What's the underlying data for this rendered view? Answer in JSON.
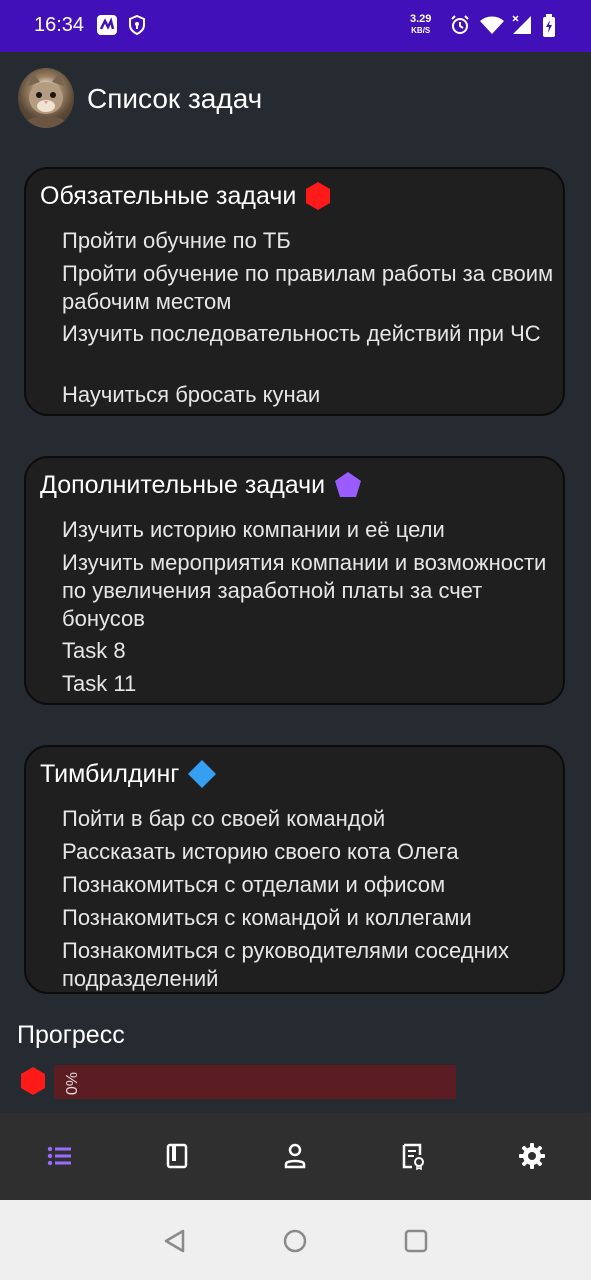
{
  "status_bar": {
    "time": "16:34",
    "net_speed_value": "3.29",
    "net_speed_unit": "KB/S"
  },
  "header": {
    "title": "Список задач",
    "avatar_icon": "cat-avatar"
  },
  "cards": [
    {
      "title": "Обязательные задачи",
      "badge": "red-hexagon-icon",
      "badge_color": "#ff1a1a",
      "tasks": [
        "Пройти обучние по ТБ",
        "Пройти обучение по правилам работы за своим рабочим местом",
        "Изучить последовательность действий при ЧС",
        "Научиться бросать кунаи"
      ]
    },
    {
      "title": "Дополнительные задачи",
      "badge": "purple-pentagon-icon",
      "badge_color": "#9b5cff",
      "tasks": [
        "Изучить историю компании и её цели",
        "Изучить мероприятия компании и возможности по увеличения заработной платы за счет бонусов",
        "Task 8",
        "Task 11"
      ]
    },
    {
      "title": "Тимбилдинг",
      "badge": "blue-diamond-icon",
      "badge_color": "#35a0f2",
      "tasks": [
        "Пойти в бар со своей командой",
        "Рассказать историю своего кота Олега",
        "Познакомиться с отделами и офисом",
        "Познакомиться с командой и коллегами",
        "Познакомиться с руководителями соседних подразделений"
      ]
    }
  ],
  "progress": {
    "label": "Прогресс",
    "icon": "red-hexagon-icon",
    "percent_text": "%0",
    "value_percent": 0
  },
  "bottom_nav": {
    "items": [
      "list-icon",
      "book-icon",
      "person-icon",
      "document-icon",
      "gear-icon"
    ],
    "active_color": "#9b6bff"
  },
  "system_nav": [
    "back-icon",
    "home-icon",
    "recents-icon"
  ]
}
